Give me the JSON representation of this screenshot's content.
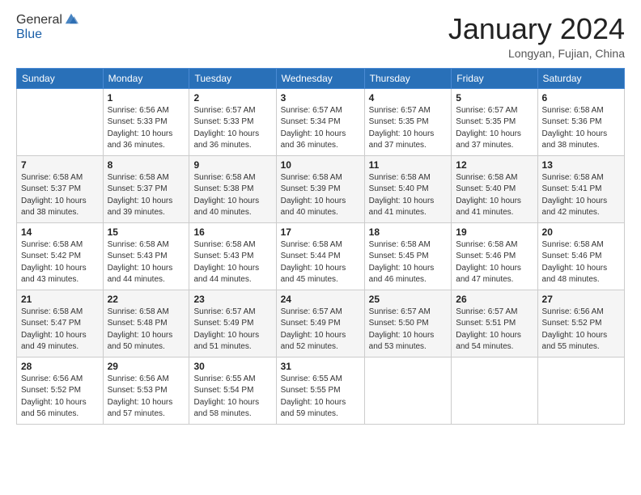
{
  "header": {
    "logo": {
      "general": "General",
      "blue": "Blue"
    },
    "month_year": "January 2024",
    "location": "Longyan, Fujian, China"
  },
  "days_of_week": [
    "Sunday",
    "Monday",
    "Tuesday",
    "Wednesday",
    "Thursday",
    "Friday",
    "Saturday"
  ],
  "weeks": [
    [
      {
        "day": "",
        "info": ""
      },
      {
        "day": "1",
        "info": "Sunrise: 6:56 AM\nSunset: 5:33 PM\nDaylight: 10 hours\nand 36 minutes."
      },
      {
        "day": "2",
        "info": "Sunrise: 6:57 AM\nSunset: 5:33 PM\nDaylight: 10 hours\nand 36 minutes."
      },
      {
        "day": "3",
        "info": "Sunrise: 6:57 AM\nSunset: 5:34 PM\nDaylight: 10 hours\nand 36 minutes."
      },
      {
        "day": "4",
        "info": "Sunrise: 6:57 AM\nSunset: 5:35 PM\nDaylight: 10 hours\nand 37 minutes."
      },
      {
        "day": "5",
        "info": "Sunrise: 6:57 AM\nSunset: 5:35 PM\nDaylight: 10 hours\nand 37 minutes."
      },
      {
        "day": "6",
        "info": "Sunrise: 6:58 AM\nSunset: 5:36 PM\nDaylight: 10 hours\nand 38 minutes."
      }
    ],
    [
      {
        "day": "7",
        "info": "Sunrise: 6:58 AM\nSunset: 5:37 PM\nDaylight: 10 hours\nand 38 minutes."
      },
      {
        "day": "8",
        "info": "Sunrise: 6:58 AM\nSunset: 5:37 PM\nDaylight: 10 hours\nand 39 minutes."
      },
      {
        "day": "9",
        "info": "Sunrise: 6:58 AM\nSunset: 5:38 PM\nDaylight: 10 hours\nand 40 minutes."
      },
      {
        "day": "10",
        "info": "Sunrise: 6:58 AM\nSunset: 5:39 PM\nDaylight: 10 hours\nand 40 minutes."
      },
      {
        "day": "11",
        "info": "Sunrise: 6:58 AM\nSunset: 5:40 PM\nDaylight: 10 hours\nand 41 minutes."
      },
      {
        "day": "12",
        "info": "Sunrise: 6:58 AM\nSunset: 5:40 PM\nDaylight: 10 hours\nand 41 minutes."
      },
      {
        "day": "13",
        "info": "Sunrise: 6:58 AM\nSunset: 5:41 PM\nDaylight: 10 hours\nand 42 minutes."
      }
    ],
    [
      {
        "day": "14",
        "info": "Sunrise: 6:58 AM\nSunset: 5:42 PM\nDaylight: 10 hours\nand 43 minutes."
      },
      {
        "day": "15",
        "info": "Sunrise: 6:58 AM\nSunset: 5:43 PM\nDaylight: 10 hours\nand 44 minutes."
      },
      {
        "day": "16",
        "info": "Sunrise: 6:58 AM\nSunset: 5:43 PM\nDaylight: 10 hours\nand 44 minutes."
      },
      {
        "day": "17",
        "info": "Sunrise: 6:58 AM\nSunset: 5:44 PM\nDaylight: 10 hours\nand 45 minutes."
      },
      {
        "day": "18",
        "info": "Sunrise: 6:58 AM\nSunset: 5:45 PM\nDaylight: 10 hours\nand 46 minutes."
      },
      {
        "day": "19",
        "info": "Sunrise: 6:58 AM\nSunset: 5:46 PM\nDaylight: 10 hours\nand 47 minutes."
      },
      {
        "day": "20",
        "info": "Sunrise: 6:58 AM\nSunset: 5:46 PM\nDaylight: 10 hours\nand 48 minutes."
      }
    ],
    [
      {
        "day": "21",
        "info": "Sunrise: 6:58 AM\nSunset: 5:47 PM\nDaylight: 10 hours\nand 49 minutes."
      },
      {
        "day": "22",
        "info": "Sunrise: 6:58 AM\nSunset: 5:48 PM\nDaylight: 10 hours\nand 50 minutes."
      },
      {
        "day": "23",
        "info": "Sunrise: 6:57 AM\nSunset: 5:49 PM\nDaylight: 10 hours\nand 51 minutes."
      },
      {
        "day": "24",
        "info": "Sunrise: 6:57 AM\nSunset: 5:49 PM\nDaylight: 10 hours\nand 52 minutes."
      },
      {
        "day": "25",
        "info": "Sunrise: 6:57 AM\nSunset: 5:50 PM\nDaylight: 10 hours\nand 53 minutes."
      },
      {
        "day": "26",
        "info": "Sunrise: 6:57 AM\nSunset: 5:51 PM\nDaylight: 10 hours\nand 54 minutes."
      },
      {
        "day": "27",
        "info": "Sunrise: 6:56 AM\nSunset: 5:52 PM\nDaylight: 10 hours\nand 55 minutes."
      }
    ],
    [
      {
        "day": "28",
        "info": "Sunrise: 6:56 AM\nSunset: 5:52 PM\nDaylight: 10 hours\nand 56 minutes."
      },
      {
        "day": "29",
        "info": "Sunrise: 6:56 AM\nSunset: 5:53 PM\nDaylight: 10 hours\nand 57 minutes."
      },
      {
        "day": "30",
        "info": "Sunrise: 6:55 AM\nSunset: 5:54 PM\nDaylight: 10 hours\nand 58 minutes."
      },
      {
        "day": "31",
        "info": "Sunrise: 6:55 AM\nSunset: 5:55 PM\nDaylight: 10 hours\nand 59 minutes."
      },
      {
        "day": "",
        "info": ""
      },
      {
        "day": "",
        "info": ""
      },
      {
        "day": "",
        "info": ""
      }
    ]
  ]
}
